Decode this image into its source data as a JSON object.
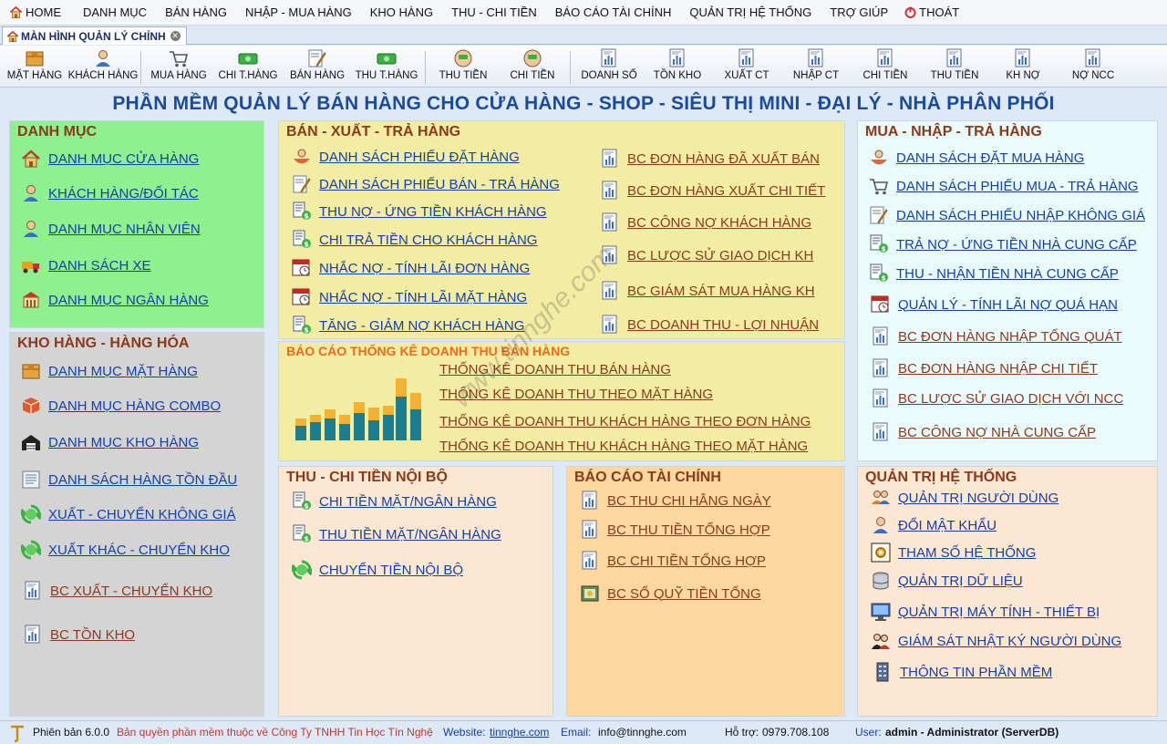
{
  "menu": {
    "items": [
      "HOME",
      "DANH MỤC",
      "BÁN HÀNG",
      "NHẬP - MUA HÀNG",
      "KHO HÀNG",
      "THU - CHI TIỀN",
      "BÁO CÁO TÀI CHÍNH",
      "QUẢN TRỊ HỆ THỐNG",
      "TRỢ GIÚP",
      "THOÁT"
    ]
  },
  "tab": {
    "label": "MÀN HÌNH QUẢN LÝ CHÍNH"
  },
  "toolbar": {
    "items": [
      "MẶT HÀNG",
      "KHÁCH HÀNG",
      "MUA HÀNG",
      "CHI T.HÀNG",
      "BÁN HÀNG",
      "THU T.HÀNG",
      "THU TIỀN",
      "CHI TIỀN",
      "DOANH SỐ",
      "TỒN KHO",
      "XUẤT CT",
      "NHẬP CT",
      "CHI TIỀN",
      "THU TIỀN",
      "KH NỢ",
      "NỢ NCC"
    ]
  },
  "banner": "PHẦN MỀM QUẢN LÝ BÁN HÀNG CHO CỬA HÀNG - SHOP - SIÊU THỊ MINI - ĐẠI LÝ - NHÀ PHÂN PHỐI",
  "panels": {
    "danhmuc": {
      "title": "DANH MỤC",
      "items": [
        "DANH MỤC CỬA HÀNG",
        "KHÁCH HÀNG/ĐỐI TÁC",
        "DANH MỤC NHÂN VIÊN",
        "DANH SÁCH XE",
        "DANH MỤC NGÂN HÀNG"
      ]
    },
    "kho": {
      "title": "KHO HÀNG - HÀNG HÓA",
      "items": [
        "DANH MỤC MẶT HÀNG",
        "DANH MỤC HÀNG COMBO",
        "DANH MỤC KHO HÀNG",
        "DANH SÁCH HÀNG TỒN ĐẦU",
        "XUẤT - CHUYỂN KHÔNG GIÁ",
        "XUẤT KHÁC - CHUYỂN KHO",
        "BC XUẤT - CHUYỂN KHO",
        "BC TỒN KHO"
      ]
    },
    "ban": {
      "title": "BÁN - XUẤT - TRẢ HÀNG",
      "left_items": [
        "DANH SÁCH PHIẾU ĐẶT HÀNG",
        "DANH SÁCH PHIẾU BÁN - TRẢ HÀNG",
        "THU NỢ - ỨNG TIỀN KHÁCH HÀNG",
        "CHI TRẢ TIỀN CHO KHÁCH HÀNG",
        "NHẮC NỢ - TÍNH LÃI  ĐƠN HÀNG",
        "NHẮC NỢ - TÍNH LÃI MẶT HÀNG",
        "TĂNG - GIẢM NỢ KHÁCH HÀNG"
      ],
      "right_items": [
        "BC ĐƠN HÀNG ĐÃ XUẤT BÁN",
        "BC ĐƠN HÀNG XUẤT CHI TIẾT",
        "BC CÔNG NỢ KHÁCH HÀNG",
        "BC LƯỢC SỬ GIAO DỊCH KH",
        "BC GIÁM SÁT MUA HÀNG KH",
        "BC DOANH THU - LỢI NHUẬN"
      ]
    },
    "baocao": {
      "title": "BÁO CÁO THỐNG KÊ DOANH THU BÁN HÀNG",
      "items": [
        "THỐNG KÊ DOANH THU BÁN HÀNG",
        "THỐNG KÊ DOANH THU THEO MẶT HÀNG",
        "THỐNG KÊ DOANH THU KHÁCH HÀNG THEO ĐƠN HÀNG",
        "THỐNG KÊ DOANH THU KHÁCH HÀNG THEO MẶT HÀNG"
      ]
    },
    "thuchi": {
      "title": "THU - CHI TIỀN NỘI BỘ",
      "items": [
        "CHI TIỀN MẶT/NGÂN HÀNG",
        "THU TIỀN MẶT/NGÂN HÀNG",
        "CHUYỂN TIỀN NỘI BỘ"
      ]
    },
    "taichinh": {
      "title": "BÁO CÁO TÀI CHÍNH",
      "items": [
        "BC THU CHI HẰNG NGÀY",
        "BC THU TIỀN TỔNG HỢP",
        "BC CHI TIỀN TỔNG HỢP",
        "BC SỔ QUỸ TIỀN TỔNG"
      ]
    },
    "mua": {
      "title": "MUA - NHẬP - TRẢ HÀNG",
      "items": [
        "DANH SÁCH ĐẶT MUA HÀNG",
        "DANH SÁCH PHIẾU MUA - TRẢ HÀNG",
        "DANH SÁCH PHIẾU NHẬP KHÔNG GIÁ",
        "TRẢ NỢ - ỨNG TIỀN NHÀ CUNG CẤP",
        "THU - NHẬN TIỀN NHÀ CUNG CẤP",
        "QUẢN LÝ - TÍNH LÃI  NỢ QUÁ HẠN",
        "BC ĐƠN HÀNG NHẬP TỔNG QUÁT",
        "BC ĐƠN HÀNG NHẬP CHI TIẾT",
        "BC LƯỢC SỬ GIAO DỊCH VỚI NCC",
        "BC CÔNG NỢ NHÀ CUNG CẤP"
      ]
    },
    "quantri": {
      "title": "QUẢN TRỊ HỆ THỐNG",
      "items": [
        "QUẢN TRỊ NGƯỜI DÙNG",
        "ĐỔI MẬT KHẨU",
        "THAM SỐ HỆ THỐNG",
        "QUẢN TRỊ DỮ LIỆU",
        "QUẢN TRỊ MÁY TÍNH - THIẾT BỊ",
        "GIÁM SÁT NHẬT KÝ NGƯỜI DÙNG",
        "THÔNG TIN PHẦN MỀM"
      ]
    }
  },
  "status": {
    "version": "Phiên bản 6.0.0",
    "copyright": "Bản quyền phần mềm thuộc về Công Ty TNHH Tin Học Tín Nghệ",
    "website_label": "Website:",
    "website": "tinnghe.com",
    "email_label": "Email:",
    "email": "info@tinnghe.com",
    "support_label": "Hỗ trợ:",
    "support": "0979.708.108",
    "user_label": "User:",
    "user": "admin - Administrator (ServerDB)"
  },
  "watermark": "www.tinnghe.com",
  "colors": {
    "title_brown": "#8a3a1c",
    "link_blue": "#1440a8",
    "banner_blue": "#1a4b9c",
    "danhmuc_bg": "#8ef08e",
    "kho_bg": "#d4d4d4",
    "ban_bg": "#f3eca3",
    "mua_bg": "#e9fbfb",
    "taichinh_bg": "#fcd79f",
    "thuchi_bg": "#fce8d2"
  }
}
